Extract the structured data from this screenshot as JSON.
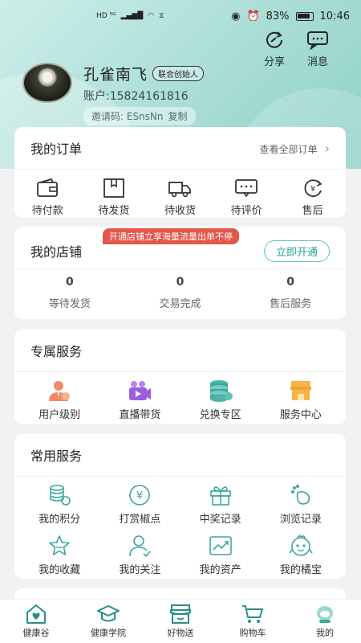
{
  "status_bar": {
    "left": "HD ⁵ᴳ",
    "battery": "83%",
    "time": "10:46"
  },
  "header": {
    "share_label": "分享",
    "message_label": "消息",
    "user_name": "孔雀南飞",
    "user_role": "联合创始人",
    "account_text": "账户:15824161816",
    "invite_text": "邀请码: ESnsNn",
    "copy_label": "复制"
  },
  "orders": {
    "title": "我的订单",
    "view_all": "查看全部订单",
    "items": [
      {
        "label": "待付款",
        "icon": "wallet-icon"
      },
      {
        "label": "待发货",
        "icon": "package-icon"
      },
      {
        "label": "待收货",
        "icon": "truck-icon"
      },
      {
        "label": "待评价",
        "icon": "comment-icon"
      },
      {
        "label": "售后",
        "icon": "refund-icon"
      }
    ]
  },
  "shop": {
    "title": "我的店铺",
    "promo": "开通店铺立享海量流量出单不停",
    "open_button": "立即开通",
    "stats": [
      {
        "value": "0",
        "label": "等待发货"
      },
      {
        "value": "0",
        "label": "交易完成"
      },
      {
        "value": "0",
        "label": "售后服务"
      }
    ]
  },
  "exclusive": {
    "title": "专属服务",
    "items": [
      {
        "label": "用户级别",
        "icon": "user-level-icon"
      },
      {
        "label": "直播带货",
        "icon": "live-video-icon"
      },
      {
        "label": "兑换专区",
        "icon": "coins-stack-icon"
      },
      {
        "label": "服务中心",
        "icon": "store-icon"
      }
    ]
  },
  "common": {
    "title": "常用服务",
    "items": [
      {
        "label": "我的积分",
        "icon": "points-icon"
      },
      {
        "label": "打赏椒点",
        "icon": "yen-coin-icon"
      },
      {
        "label": "中奖记录",
        "icon": "gift-icon"
      },
      {
        "label": "浏览记录",
        "icon": "footprint-icon"
      },
      {
        "label": "我的收藏",
        "icon": "star-icon"
      },
      {
        "label": "我的关注",
        "icon": "follow-user-icon"
      },
      {
        "label": "我的资产",
        "icon": "chart-icon"
      },
      {
        "label": "我的橘宝",
        "icon": "mascot-icon"
      }
    ]
  },
  "bottom_nav": [
    {
      "label": "健康谷",
      "icon": "health-home-icon"
    },
    {
      "label": "健康学院",
      "icon": "graduation-cap-icon"
    },
    {
      "label": "好物送",
      "icon": "shop-icon"
    },
    {
      "label": "购物车",
      "icon": "cart-icon"
    },
    {
      "label": "我的",
      "icon": "profile-mascot-icon"
    }
  ],
  "colors": {
    "accent": "#5ec4b6",
    "promo": "#e4574c",
    "icon_teal": "#3aa89c",
    "icon_orange": "#f0a23a",
    "icon_purple": "#9b5fe0"
  }
}
